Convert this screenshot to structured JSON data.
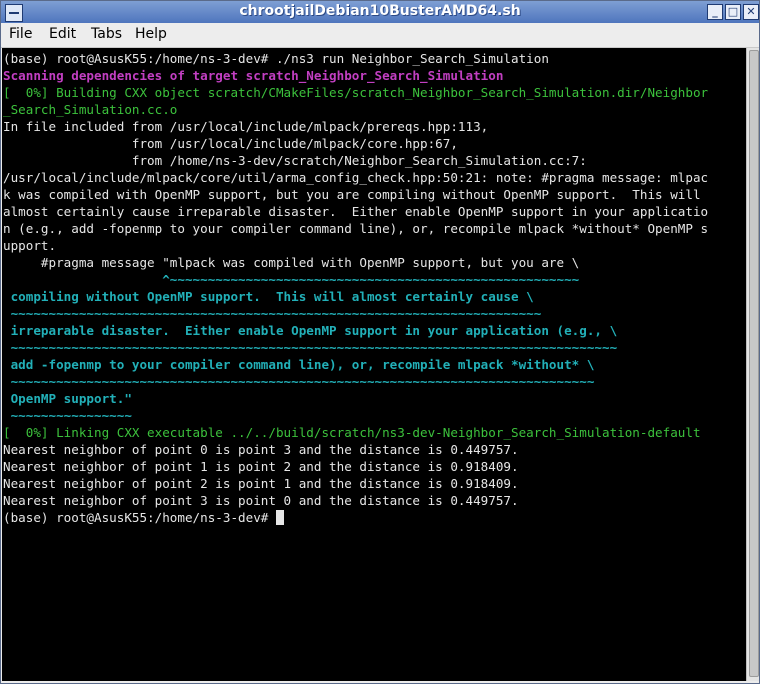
{
  "window": {
    "title": "chrootjailDebian10BusterAMD64.sh",
    "buttons": {
      "minimize": "_",
      "maximize": "□",
      "close": "✕"
    }
  },
  "menu": [
    "File",
    "Edit",
    "Tabs",
    "Help"
  ],
  "terminal": {
    "lines": [
      {
        "cls": "",
        "text": "(base) root@AsusK55:/home/ns-3-dev# ./ns3 run Neighbor_Search_Simulation"
      },
      {
        "cls": "mag",
        "text": "Scanning dependencies of target scratch_Neighbor_Search_Simulation"
      },
      {
        "cls": "grn",
        "text": "[  0%] Building CXX object scratch/CMakeFiles/scratch_Neighbor_Search_Simulation.dir/Neighbor"
      },
      {
        "cls": "grn",
        "text": "_Search_Simulation.cc.o"
      },
      {
        "cls": "",
        "text": "In file included from /usr/local/include/mlpack/prereqs.hpp:113,"
      },
      {
        "cls": "",
        "text": "                 from /usr/local/include/mlpack/core.hpp:67,"
      },
      {
        "cls": "",
        "text": "                 from /home/ns-3-dev/scratch/Neighbor_Search_Simulation.cc:7:"
      },
      {
        "cls": "",
        "text": "/usr/local/include/mlpack/core/util/arma_config_check.hpp:50:21: note: #pragma message: mlpac"
      },
      {
        "cls": "",
        "text": "k was compiled with OpenMP support, but you are compiling without OpenMP support.  This will"
      },
      {
        "cls": "",
        "text": "almost certainly cause irreparable disaster.  Either enable OpenMP support in your applicatio"
      },
      {
        "cls": "",
        "text": "n (e.g., add -fopenmp to your compiler command line), or, recompile mlpack *without* OpenMP s"
      },
      {
        "cls": "",
        "text": "upport."
      },
      {
        "cls": "",
        "text": "     #pragma message \"mlpack was compiled with OpenMP support, but you are \\"
      },
      {
        "cls": "cy",
        "text": "                     ^~~~~~~~~~~~~~~~~~~~~~~~~~~~~~~~~~~~~~~~~~~~~~~~~~~~~~~"
      },
      {
        "cls": "cy",
        "text": " compiling without OpenMP support.  This will almost certainly cause \\"
      },
      {
        "cls": "cy",
        "text": " ~~~~~~~~~~~~~~~~~~~~~~~~~~~~~~~~~~~~~~~~~~~~~~~~~~~~~~~~~~~~~~~~~~~~~~"
      },
      {
        "cls": "cy",
        "text": " irreparable disaster.  Either enable OpenMP support in your application (e.g., \\"
      },
      {
        "cls": "cy",
        "text": " ~~~~~~~~~~~~~~~~~~~~~~~~~~~~~~~~~~~~~~~~~~~~~~~~~~~~~~~~~~~~~~~~~~~~~~~~~~~~~~~~"
      },
      {
        "cls": "cy",
        "text": " add -fopenmp to your compiler command line), or, recompile mlpack *without* \\"
      },
      {
        "cls": "cy",
        "text": " ~~~~~~~~~~~~~~~~~~~~~~~~~~~~~~~~~~~~~~~~~~~~~~~~~~~~~~~~~~~~~~~~~~~~~~~~~~~~~"
      },
      {
        "cls": "cy",
        "text": " OpenMP support.\""
      },
      {
        "cls": "cy",
        "text": " ~~~~~~~~~~~~~~~~"
      },
      {
        "cls": "grn",
        "text": "[  0%] Linking CXX executable ../../build/scratch/ns3-dev-Neighbor_Search_Simulation-default"
      },
      {
        "cls": "",
        "text": "Nearest neighbor of point 0 is point 3 and the distance is 0.449757."
      },
      {
        "cls": "",
        "text": "Nearest neighbor of point 1 is point 2 and the distance is 0.918409."
      },
      {
        "cls": "",
        "text": "Nearest neighbor of point 2 is point 1 and the distance is 0.918409."
      },
      {
        "cls": "",
        "text": "Nearest neighbor of point 3 is point 0 and the distance is 0.449757."
      },
      {
        "cls": "",
        "text": "(base) root@AsusK55:/home/ns-3-dev# ",
        "cursor": true
      }
    ]
  }
}
